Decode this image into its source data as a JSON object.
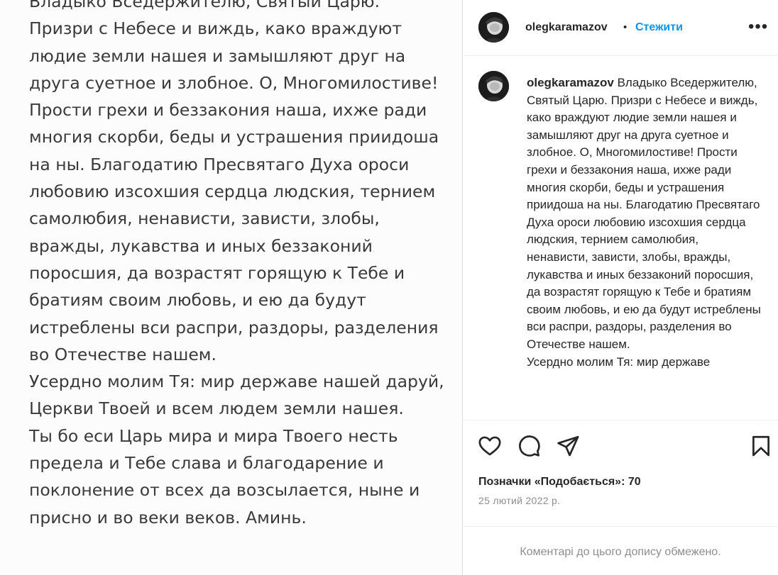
{
  "image": {
    "paragraphs": [
      "Владыко Вседержителю, Святый Царю. Призри с Небесе и виждь, како враждуют людие земли нашея и замышляют друг на друга суетное и злобное. О, Многомилостиве! Прости грехи и беззакония наша, ихже ради многия скорби, беды и устрашения приидоша на ны. Благодатию Пресвятаго Духа ороси любовию изсохшия сердца людския, тернием самолюбия, ненависти, зависти, злобы, вражды, лукавства и иных беззаконий поросшия, да возрастят горящую к Тебе и братиям своим любовь, и ею да будут истреблены вси распри, раздоры, разделения во Отечестве нашем.",
      "Усердно молим Тя: мир державе нашей даруй, Церкви Твоей и всем людем земли нашея.",
      "Ты бо еси Царь мира и мира Твоего несть предела и Тебе слава и благодарение и поклонение от всех да возсылается, ныне и присно и во веки веков. Аминь."
    ]
  },
  "header": {
    "username": "olegkaramazov",
    "separator": "•",
    "follow_label": "Стежити",
    "more_label": "•••"
  },
  "caption": {
    "username": "olegkaramazov",
    "paragraphs": [
      "Владыко Вседержителю, Святый Царю. Призри с Небесе и виждь, како враждуют людие земли нашея и замышляют друг на друга суетное и злобное. О, Многомилостиве! Прости грехи и беззакония наша, ихже ради многия скорби, беды и устрашения приидоша на ны. Благодатию Пресвятаго Духа ороси любовию изсохшия сердца людския, тернием самолюбия, ненависти, зависти, злобы, вражды, лукавства и иных беззаконий поросшия, да возрастят горящую к Тебе и братиям своим любовь, и ею да будут истреблены вси распри, раздоры, разделения во Отечестве нашем.",
      "Усердно молим Тя: мир державе"
    ]
  },
  "actions": {
    "icons": [
      "heart-icon",
      "comment-icon",
      "share-icon",
      "bookmark-icon"
    ],
    "likes_text": "Позначки «Подобається»: 70",
    "date_text": "25 лютий 2022 р."
  },
  "comments": {
    "limited_text": "Коментарі до цього допису обмежено."
  },
  "colors": {
    "accent": "#0095f6",
    "text": "#262626",
    "muted": "#8e8e8e",
    "border": "#dbdbdb"
  }
}
